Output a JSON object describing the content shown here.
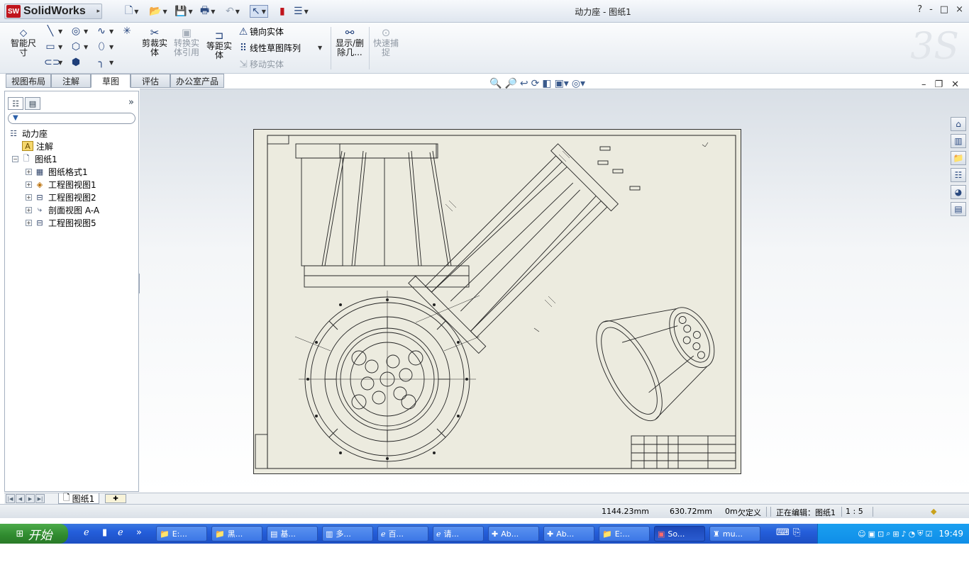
{
  "app": {
    "name": "SolidWorks",
    "logo_text": "SW",
    "document_title": "动力座 - 图纸1",
    "window_controls": [
      "?",
      "-",
      "□",
      "×"
    ]
  },
  "quick_access": [
    {
      "icon": "new-document-icon",
      "glyph": "□"
    },
    {
      "icon": "open-folder-icon",
      "glyph": "📂"
    },
    {
      "icon": "save-icon",
      "glyph": "💾"
    },
    {
      "icon": "print-icon",
      "glyph": "🖨"
    },
    {
      "icon": "undo-icon",
      "glyph": "↶"
    },
    {
      "icon": "select-arrow-icon",
      "glyph": "↖"
    },
    {
      "icon": "rebuild-icon",
      "glyph": "▮"
    },
    {
      "icon": "options-icon",
      "glyph": "☰"
    }
  ],
  "ribbon": {
    "smart_dimension": "智能尺寸",
    "trim_entities": "剪裁实体",
    "convert_entities": "转换实体引用",
    "offset_entities": "等距实体",
    "mirror_entities": "镜向实体",
    "linear_pattern": "线性草图阵列",
    "move_entities": "移动实体",
    "display_delete": "显示/删除几...",
    "quick_snaps": "快速捕捉"
  },
  "tabs": [
    {
      "label": "视图布局",
      "active": false
    },
    {
      "label": "注解",
      "active": false
    },
    {
      "label": "草图",
      "active": true
    },
    {
      "label": "评估",
      "active": false
    },
    {
      "label": "办公室产品",
      "active": false
    }
  ],
  "feature_tree": {
    "root": "动力座",
    "annotations": "注解",
    "sheet": "图纸1",
    "children": [
      {
        "label": "图纸格式1",
        "icon": "sheet-format-icon"
      },
      {
        "label": "工程图视图1",
        "icon": "drawing-view-icon"
      },
      {
        "label": "工程图视图2",
        "icon": "drawing-view-icon"
      },
      {
        "label": "剖面视图 A-A",
        "icon": "section-view-icon"
      },
      {
        "label": "工程图视图5",
        "icon": "drawing-view-icon"
      }
    ]
  },
  "sheet_tab": "图纸1",
  "status": {
    "x": "1144.23mm",
    "y": "630.72mm",
    "z": "0m",
    "definition": "欠定义",
    "editing": "正在编辑：图纸1",
    "scale": "1 : 5"
  },
  "taskbar": {
    "start_label": "开始",
    "tasks": [
      {
        "label": "E:...",
        "icon": "folder-icon",
        "active": false
      },
      {
        "label": "黑...",
        "icon": "folder-icon",
        "active": false
      },
      {
        "label": "基...",
        "icon": "pdf-icon",
        "active": false
      },
      {
        "label": "多...",
        "icon": "document-icon",
        "active": false
      },
      {
        "label": "百...",
        "icon": "ie-icon",
        "active": false
      },
      {
        "label": "请...",
        "icon": "ie-icon",
        "active": false
      },
      {
        "label": "Ab...",
        "icon": "app-icon",
        "active": false
      },
      {
        "label": "Ab...",
        "icon": "app-icon",
        "active": false
      },
      {
        "label": "E:...",
        "icon": "folder-icon",
        "active": false
      },
      {
        "label": "So...",
        "icon": "solidworks-icon",
        "active": true
      },
      {
        "label": "mu...",
        "icon": "app-icon",
        "active": false
      }
    ],
    "clock": "19:49"
  },
  "colors": {
    "brand_red": "#c0141c",
    "sheet_background": "#ecebdf",
    "taskbar_blue": "#245edb",
    "start_green": "#2f8a2e"
  }
}
